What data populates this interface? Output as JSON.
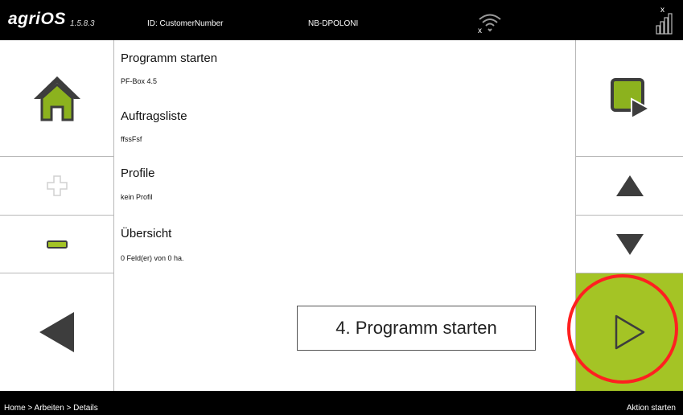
{
  "header": {
    "brand": "agriOS",
    "version": "1.5.8.3",
    "customer_id": "ID: CustomerNumber",
    "device": "NB-DPOLONI",
    "wifi_icon": "wifi-disconnected-icon",
    "signal_icon": "signal-strength-icon"
  },
  "left_panel": {
    "home_icon": "home-icon",
    "plus_icon": "plus-icon",
    "minus_icon": "minus-icon",
    "back_icon": "back-arrow-icon"
  },
  "right_panel": {
    "select_icon": "select-field-icon",
    "up_icon": "arrow-up-icon",
    "down_icon": "arrow-down-icon",
    "start_icon": "play-icon"
  },
  "sections": [
    {
      "title": "Programm starten",
      "value": "PF-Box 4.5"
    },
    {
      "title": "Auftragsliste",
      "value": "ffssFsf"
    },
    {
      "title": "Profile",
      "value": "kein Profil"
    },
    {
      "title": "Übersicht",
      "value": "0 Feld(er) von 0 ha."
    }
  ],
  "callout": "4. Programm starten",
  "footer": {
    "breadcrumb": "Home > Arbeiten > Details",
    "action": "Aktion starten"
  },
  "colors": {
    "accent_green": "#a4c425",
    "highlight_red": "#ff2020",
    "bar_black": "#000000"
  }
}
